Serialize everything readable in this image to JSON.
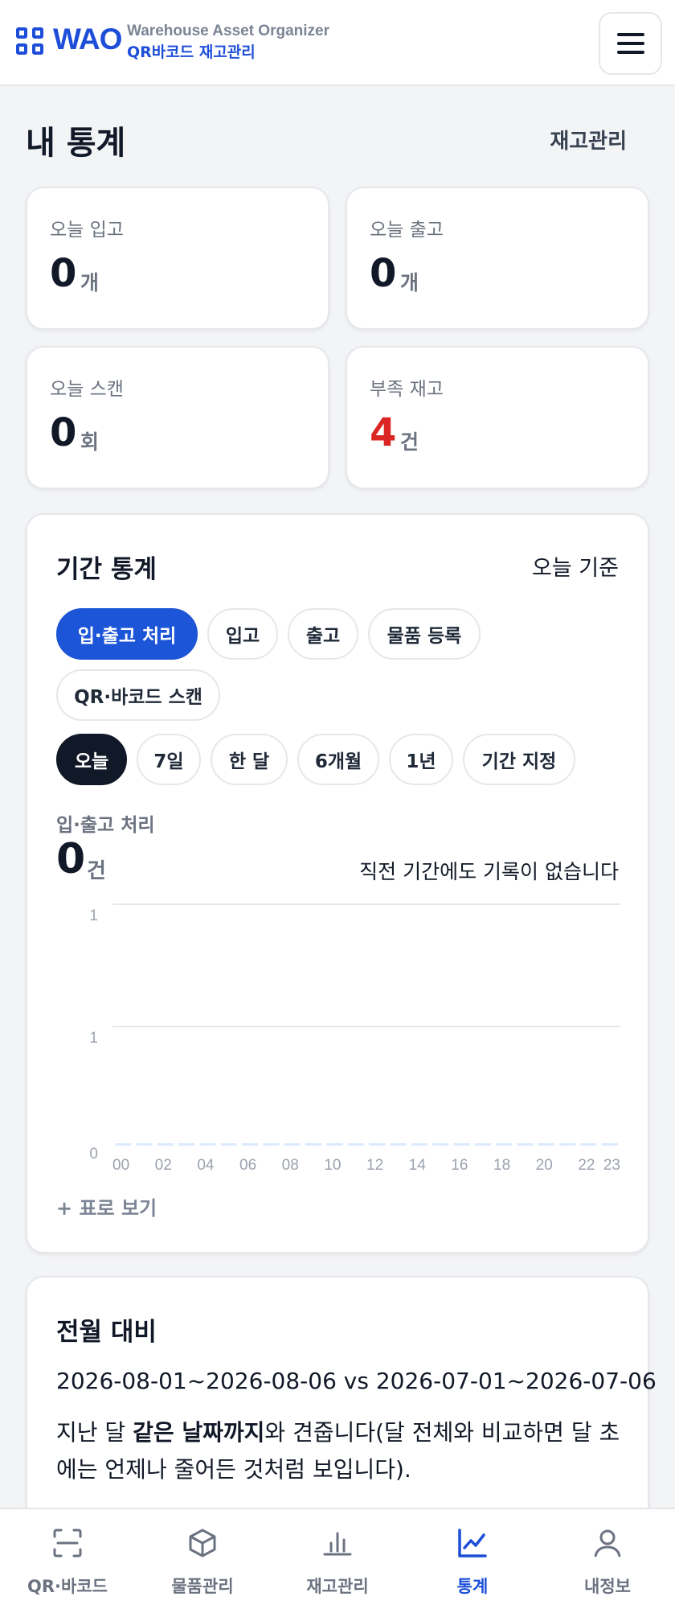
{
  "header": {
    "logo_text": "WAO",
    "subtitle_en": "Warehouse Asset Organizer",
    "subtitle_ko": "QR바코드 재고관리",
    "menu_icon": "hamburger-menu-icon"
  },
  "page": {
    "title": "내 통계",
    "link": "재고관리"
  },
  "stats": [
    {
      "label": "오늘 입고",
      "value": "0",
      "unit": "개",
      "color": "#111827"
    },
    {
      "label": "오늘 출고",
      "value": "0",
      "unit": "개",
      "color": "#111827"
    },
    {
      "label": "오늘 스캔",
      "value": "0",
      "unit": "회",
      "color": "#111827"
    },
    {
      "label": "부족 재고",
      "value": "4",
      "unit": "건",
      "color": "#dc2626"
    }
  ],
  "period": {
    "title": "기간 통계",
    "basis": "오늘 기준",
    "type_filters": [
      "입·출고 처리",
      "입고",
      "출고",
      "물품 등록",
      "QR·바코드 스캔"
    ],
    "type_selected": "입·출고 처리",
    "range_filters": [
      "오늘",
      "7일",
      "한 달",
      "6개월",
      "1년",
      "기간 지정"
    ],
    "range_selected": "오늘",
    "metric_label": "입·출고 처리",
    "metric_value": "0",
    "metric_unit": "건",
    "metric_note": "직전 기간에도 기록이 없습니다",
    "table_toggle": "+ 표로 보기"
  },
  "chart_data": {
    "type": "bar",
    "title": "",
    "xlabel": "",
    "ylabel": "",
    "y_tick_labels": [
      "1",
      "1",
      "0"
    ],
    "x_tick_labels": [
      "00",
      "02",
      "04",
      "06",
      "08",
      "10",
      "12",
      "14",
      "16",
      "18",
      "20",
      "22",
      "23"
    ],
    "categories": [
      "00",
      "01",
      "02",
      "03",
      "04",
      "05",
      "06",
      "07",
      "08",
      "09",
      "10",
      "11",
      "12",
      "13",
      "14",
      "15",
      "16",
      "17",
      "18",
      "19",
      "20",
      "21",
      "22",
      "23"
    ],
    "values": [
      0,
      0,
      0,
      0,
      0,
      0,
      0,
      0,
      0,
      0,
      0,
      0,
      0,
      0,
      0,
      0,
      0,
      0,
      0,
      0,
      0,
      0,
      0,
      0
    ],
    "ylim": [
      0,
      1
    ],
    "grid": true,
    "bar_color": "#dbeafe"
  },
  "compare": {
    "title": "전월 대비",
    "range": "2026-08-01~2026-08-06 vs 2026-07-01~2026-07-06",
    "desc_pre": "지난 달 ",
    "desc_bold": "같은 날짜까지",
    "desc_post": "와 견줍니다(달 전체와 비교하면 달 초에는 언제나 줄어든 것처럼 보입니다)."
  },
  "nav": [
    {
      "label": "QR·바코드",
      "icon": "scan-icon",
      "active": false
    },
    {
      "label": "물품관리",
      "icon": "box-icon",
      "active": false
    },
    {
      "label": "재고관리",
      "icon": "bar-chart-icon",
      "active": false
    },
    {
      "label": "통계",
      "icon": "line-chart-icon",
      "active": true
    },
    {
      "label": "내정보",
      "icon": "user-icon",
      "active": false
    }
  ],
  "colors": {
    "accent": "#1d4ed8",
    "danger": "#dc2626",
    "dark": "#111827"
  }
}
